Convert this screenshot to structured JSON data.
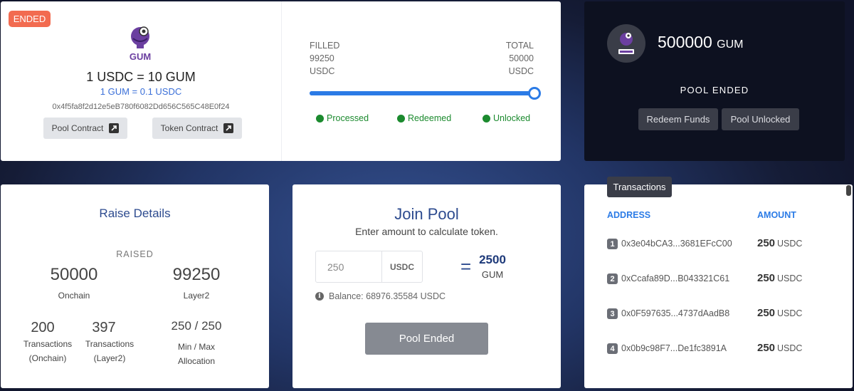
{
  "pool": {
    "badge": "ENDED",
    "logo_text": "GUM",
    "rate_main": "1 USDC = 10 GUM",
    "rate_sub": "1 GUM = 0.1 USDC",
    "address": "0x4f5fa8f2d12e5eB780f6082Dd656C565C48E0f24",
    "pool_contract_label": "Pool Contract",
    "token_contract_label": "Token Contract",
    "filled_label": "FILLED",
    "filled_value": "99250",
    "filled_unit": "USDC",
    "total_label": "TOTAL",
    "total_value": "50000",
    "total_unit": "USDC",
    "progress_fraction": 1.0,
    "statuses": [
      "Processed",
      "Redeemed",
      "Unlocked"
    ]
  },
  "summary": {
    "supply_value": "500000",
    "supply_unit": "GUM",
    "title": "POOL ENDED",
    "redeem_label": "Redeem Funds",
    "unlocked_label": "Pool Unlocked"
  },
  "raise": {
    "title": "Raise Details",
    "raised_label": "RAISED",
    "onchain_value": "50000",
    "onchain_label": "Onchain",
    "layer2_value": "99250",
    "layer2_label": "Layer2",
    "tx_onchain_value": "200",
    "tx_onchain_label1": "Transactions",
    "tx_onchain_label2": "(Onchain)",
    "tx_layer2_value": "397",
    "tx_layer2_label1": "Transactions",
    "tx_layer2_label2": "(Layer2)",
    "allocation_value": "250 / 250",
    "allocation_label1": "Min / Max",
    "allocation_label2": "Allocation"
  },
  "join": {
    "title": "Join Pool",
    "subtitle": "Enter amount to calculate token.",
    "amount_value": "250",
    "amount_unit": "USDC",
    "equals": "=",
    "calc_value": "2500",
    "calc_unit": "GUM",
    "balance": "Balance: 68976.35584 USDC",
    "button_label": "Pool Ended"
  },
  "transactions": {
    "tab_label": "Transactions",
    "address_header": "ADDRESS",
    "amount_header": "AMOUNT",
    "rows": [
      {
        "num": "1",
        "address": "0x3e04bCA3...3681EFcC00",
        "amount": "250",
        "unit": "USDC"
      },
      {
        "num": "2",
        "address": "0xCcafa89D...B043321C61",
        "amount": "250",
        "unit": "USDC"
      },
      {
        "num": "3",
        "address": "0x0F597635...4737dAadB8",
        "amount": "250",
        "unit": "USDC"
      },
      {
        "num": "4",
        "address": "0x0b9c98F7...De1fc3891A",
        "amount": "250",
        "unit": "USDC"
      }
    ]
  },
  "colors": {
    "accent_blue": "#2b7be6",
    "status_green": "#1b8a2e",
    "badge_orange": "#f26b50",
    "logo_purple": "#6b3fa0"
  },
  "icons": [
    "gum-logo",
    "external-link-icon",
    "status-dot-icon",
    "info-icon"
  ]
}
